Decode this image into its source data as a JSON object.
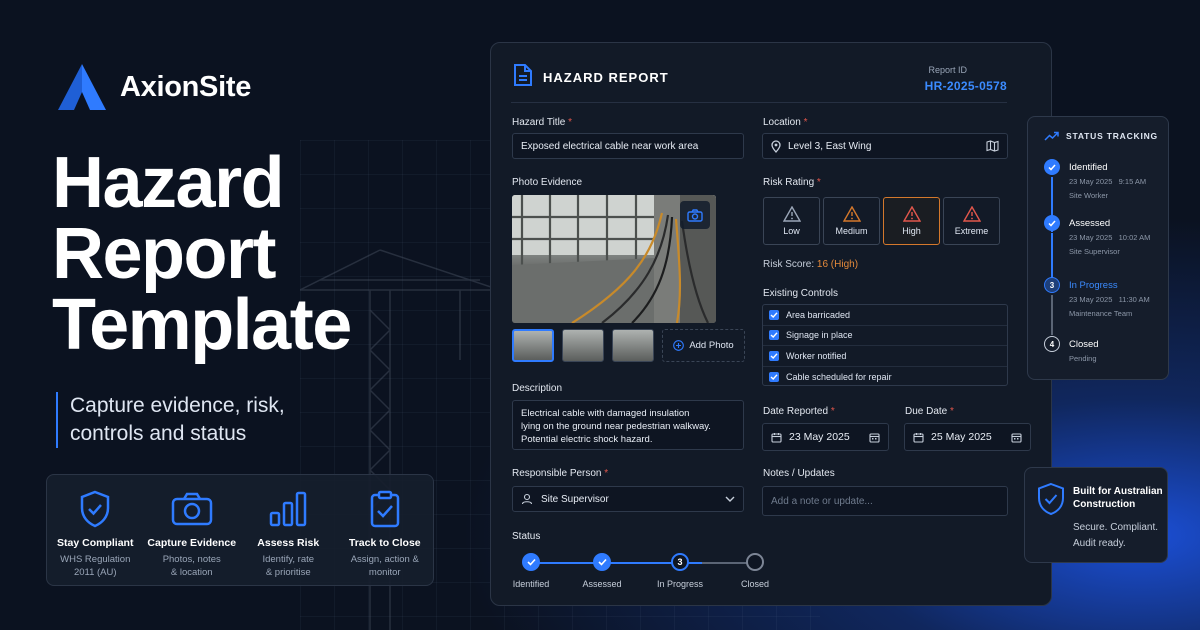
{
  "brand": {
    "name": "AxionSite"
  },
  "hero": {
    "title_lines": [
      "Hazard",
      "Report",
      "Template"
    ],
    "tagline_lines": [
      "Capture evidence, risk,",
      "controls and status"
    ]
  },
  "features": [
    {
      "icon": "shield-check-icon",
      "title": "Stay Compliant",
      "sub": "WHS Regulation\n2011 (AU)"
    },
    {
      "icon": "camera-icon",
      "title": "Capture Evidence",
      "sub": "Photos, notes\n& location"
    },
    {
      "icon": "bar-chart-icon",
      "title": "Assess Risk",
      "sub": "Identify, rate\n& prioritise"
    },
    {
      "icon": "clipboard-check-icon",
      "title": "Track to Close",
      "sub": "Assign, action &\nmonitor"
    }
  ],
  "report": {
    "title": "HAZARD REPORT",
    "id_label": "Report ID",
    "id": "HR-2025-0578",
    "hazard_title_label": "Hazard Title",
    "hazard_title": "Exposed electrical cable near work area",
    "location_label": "Location",
    "location": "Level 3, East Wing",
    "photo_label": "Photo Evidence",
    "add_photo": "Add Photo",
    "risk_label": "Risk Rating",
    "risk_options": [
      {
        "label": "Low",
        "color": "#9aa6b8"
      },
      {
        "label": "Medium",
        "color": "#d4782c"
      },
      {
        "label": "High",
        "color": "#e2574c"
      },
      {
        "label": "Extreme",
        "color": "#e2574c"
      }
    ],
    "risk_selected": "High",
    "risk_score_label": "Risk Score:",
    "risk_score_value": "16 (High)",
    "controls_label": "Existing Controls",
    "controls": [
      "Area barricaded",
      "Signage in place",
      "Worker notified",
      "Cable scheduled for repair"
    ],
    "description_label": "Description",
    "description_lines": [
      "Electrical cable with damaged insulation",
      "lying on the ground near pedestrian walkway.",
      "Potential electric shock hazard."
    ],
    "date_reported_label": "Date Reported",
    "date_reported": "23 May 2025",
    "due_date_label": "Due Date",
    "due_date": "25 May 2025",
    "responsible_label": "Responsible Person",
    "responsible": "Site Supervisor",
    "notes_label": "Notes / Updates",
    "notes_placeholder": "Add a note or update...",
    "status_label": "Status",
    "status_steps": [
      "Identified",
      "Assessed",
      "In Progress",
      "Closed"
    ],
    "status_current_number": "3",
    "required_mark": "*"
  },
  "tracking": {
    "title": "STATUS TRACKING",
    "items": [
      {
        "title": "Identified",
        "date": "23 May 2025",
        "time": "9:15 AM",
        "by": "Site Worker"
      },
      {
        "title": "Assessed",
        "date": "23 May 2025",
        "time": "10:02 AM",
        "by": "Site Supervisor"
      },
      {
        "title": "In Progress",
        "number": "3",
        "date": "23 May 2025",
        "time": "11:30 AM",
        "by": "Maintenance Team"
      },
      {
        "title": "Closed",
        "number": "4",
        "by": "Pending"
      }
    ]
  },
  "compliance": {
    "title_lines": [
      "Built for Australian",
      "Construction"
    ],
    "sub_lines": [
      "Secure. Compliant.",
      "Audit ready."
    ]
  },
  "colors": {
    "accent": "#2f7bff",
    "accent_text": "#3b8bff",
    "warning": "#d4782c",
    "danger": "#e2574c",
    "background": "#0b1220",
    "card": "#121a27"
  }
}
